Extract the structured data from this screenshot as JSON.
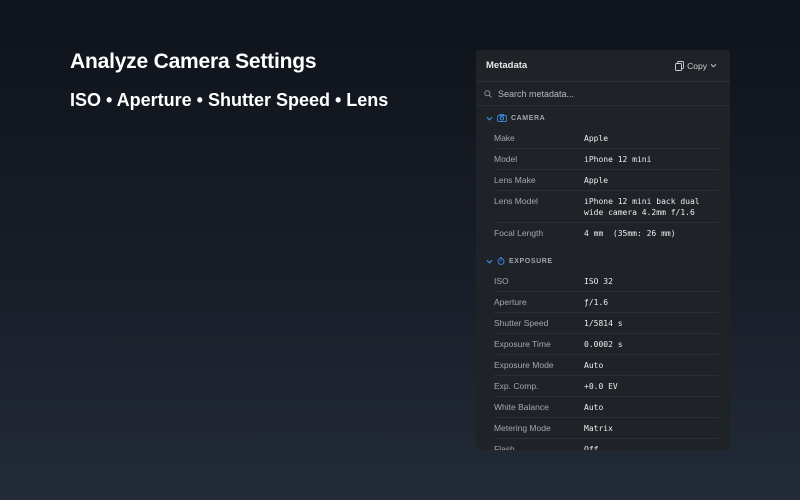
{
  "hero": {
    "title": "Analyze Camera Settings",
    "subtitle": "ISO • Aperture • Shutter Speed • Lens"
  },
  "panel": {
    "title": "Metadata",
    "copy_label": "Copy",
    "search_placeholder": "Search metadata...",
    "accent_color": "#3b8de8",
    "sections": [
      {
        "label": "CAMERA",
        "icon": "camera-icon",
        "rows": [
          {
            "label": "Make",
            "value": "Apple"
          },
          {
            "label": "Model",
            "value": "iPhone 12 mini"
          },
          {
            "label": "Lens Make",
            "value": "Apple"
          },
          {
            "label": "Lens Model",
            "value": "iPhone 12 mini back dual wide camera 4.2mm f/1.6"
          },
          {
            "label": "Focal Length",
            "value": "4 mm  (35mm: 26 mm)"
          }
        ]
      },
      {
        "label": "EXPOSURE",
        "icon": "timer-icon",
        "rows": [
          {
            "label": "ISO",
            "value": "ISO 32"
          },
          {
            "label": "Aperture",
            "value": "ƒ/1.6"
          },
          {
            "label": "Shutter Speed",
            "value": "1/5814 s"
          },
          {
            "label": "Exposure Time",
            "value": "0.0002 s"
          },
          {
            "label": "Exposure Mode",
            "value": "Auto"
          },
          {
            "label": "Exp. Comp.",
            "value": "+0.0 EV"
          },
          {
            "label": "White Balance",
            "value": "Auto"
          },
          {
            "label": "Metering Mode",
            "value": "Matrix"
          },
          {
            "label": "Flash",
            "value": "Off"
          }
        ]
      }
    ]
  }
}
